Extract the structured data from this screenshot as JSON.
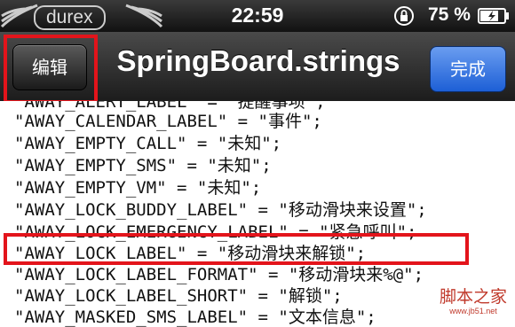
{
  "status_bar": {
    "carrier": "durex",
    "time": "22:59",
    "battery_percent": "75 %",
    "battery_level": 0.75
  },
  "nav_bar": {
    "edit_label": "编辑",
    "title": "SpringBoard.strings",
    "done_label": "完成"
  },
  "code_lines": [
    "\"AWAY_ALERT_LABEL\" = \"提醒事项\";",
    "\"AWAY_CALENDAR_LABEL\" = \"事件\";",
    "\"AWAY_EMPTY_CALL\" = \"未知\";",
    "\"AWAY_EMPTY_SMS\" = \"未知\";",
    "\"AWAY_EMPTY_VM\" = \"未知\";",
    "\"AWAY_LOCK_BUDDY_LABEL\" = \"移动滑块来设置\";",
    "\"AWAY_LOCK_EMERGENCY_LABEL\" = \"紧急呼叫\";",
    "\"AWAY_LOCK_LABEL\" = \"移动滑块来解锁\";",
    "\"AWAY_LOCK_LABEL_FORMAT\" = \"移动滑块来%@\";",
    "\"AWAY_LOCK_LABEL_SHORT\" = \"解锁\";",
    "\"AWAY_MASKED_SMS_LABEL\" = \"文本信息\";"
  ],
  "watermark": {
    "main": "脚本之家",
    "url": "www.jb51.net"
  },
  "colors": {
    "highlight": "#e3141b",
    "done_button": "#2f6fe0",
    "text": "#111111"
  }
}
